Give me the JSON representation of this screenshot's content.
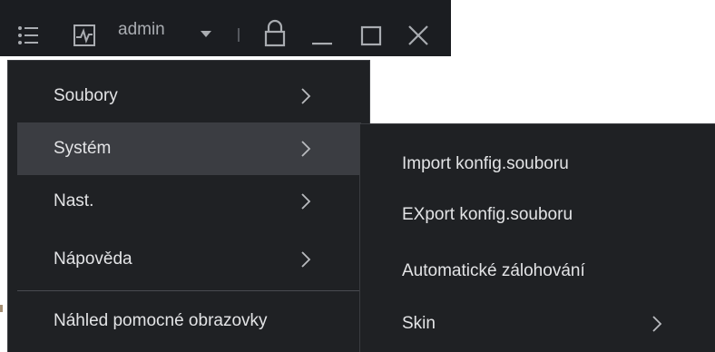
{
  "titlebar": {
    "user": "admin",
    "icons": [
      "menu-list-icon",
      "monitor-icon",
      "caret-down-icon",
      "lock-icon",
      "minimize-icon",
      "maximize-icon",
      "close-icon"
    ]
  },
  "main_menu": {
    "items": [
      {
        "label": "Soubory",
        "has_submenu": true
      },
      {
        "label": "Systém",
        "has_submenu": true,
        "active": true
      },
      {
        "label": "Nast.",
        "has_submenu": true
      },
      {
        "label": "Nápověda",
        "has_submenu": true
      },
      {
        "label": "Náhled pomocné obrazovky",
        "has_submenu": false
      }
    ]
  },
  "submenu": {
    "items": [
      {
        "label": "Import konfig.souboru",
        "has_submenu": false
      },
      {
        "label": "EXport konfig.souboru",
        "has_submenu": false
      },
      {
        "label": "Automatické zálohování",
        "has_submenu": false
      },
      {
        "label": "Skin",
        "has_submenu": true
      }
    ]
  },
  "colors": {
    "titlebar_bg": "#1b1d21",
    "menu_bg": "#1f2124",
    "active_item_bg": "#3b3d42",
    "text": "#e3e4e6",
    "icon": "#a9acb1"
  }
}
